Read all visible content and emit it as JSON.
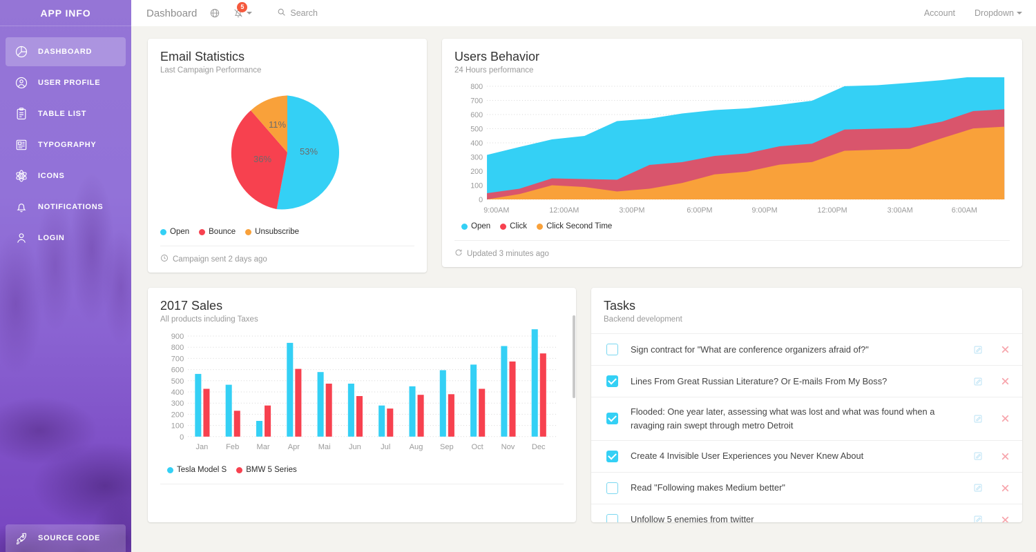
{
  "sidebar": {
    "brand": "APP INFO",
    "items": [
      {
        "label": "DASHBOARD",
        "icon": "pie-chart-icon",
        "active": true
      },
      {
        "label": "USER PROFILE",
        "icon": "user-circle-icon",
        "active": false
      },
      {
        "label": "TABLE LIST",
        "icon": "clipboard-icon",
        "active": false
      },
      {
        "label": "TYPOGRAPHY",
        "icon": "newspaper-icon",
        "active": false
      },
      {
        "label": "ICONS",
        "icon": "atom-icon",
        "active": false
      },
      {
        "label": "NOTIFICATIONS",
        "icon": "bell-icon",
        "active": false
      },
      {
        "label": "LOGIN",
        "icon": "user-icon",
        "active": false
      }
    ],
    "source_code": {
      "label": "SOURCE CODE",
      "icon": "rocket-icon"
    }
  },
  "topbar": {
    "title": "Dashboard",
    "globe_icon": "globe-icon",
    "notifications_icon": "bell-icon",
    "notifications_badge": "5",
    "search_icon": "search-icon",
    "search_label": "Search",
    "account_label": "Account",
    "dropdown_label": "Dropdown"
  },
  "cards": {
    "email_statistics": {
      "title": "Email Statistics",
      "subtitle": "Last Campaign Performance",
      "footer_icon": "clock-icon",
      "footer": "Campaign sent 2 days ago"
    },
    "users_behavior": {
      "title": "Users Behavior",
      "subtitle": "24 Hours performance",
      "footer_icon": "refresh-icon",
      "footer": "Updated 3 minutes ago"
    },
    "sales_2017": {
      "title": "2017 Sales",
      "subtitle": "All products including Taxes"
    },
    "tasks": {
      "title": "Tasks",
      "subtitle": "Backend development",
      "edit_icon": "edit-icon",
      "delete_icon": "close-icon",
      "items": [
        {
          "text": "Sign contract for \"What are conference organizers afraid of?\"",
          "done": false
        },
        {
          "text": "Lines From Great Russian Literature? Or E-mails From My Boss?",
          "done": true
        },
        {
          "text": "Flooded: One year later, assessing what was lost and what was found when a ravaging rain swept through metro Detroit",
          "done": true
        },
        {
          "text": "Create 4 Invisible User Experiences you Never Knew About",
          "done": true
        },
        {
          "text": "Read \"Following makes Medium better\"",
          "done": false
        },
        {
          "text": "Unfollow 5 enemies from twitter",
          "done": false
        }
      ]
    }
  },
  "colors": {
    "cyan": "#34d0f5",
    "red": "#f7414f",
    "orange": "#f9a13a",
    "pink": "#d9556c",
    "purple": "#8a63d2",
    "text": "#444444",
    "muted": "#9a9a9a"
  },
  "chart_data": [
    {
      "type": "pie",
      "title": "Email Statistics",
      "subtitle": "Last Campaign Performance",
      "labels": [
        "Open",
        "Bounce",
        "Unsubscribe"
      ],
      "values": [
        53,
        36,
        11
      ],
      "value_labels": [
        "53%",
        "36%",
        "11%"
      ],
      "colors": [
        "#34d0f5",
        "#f7414f",
        "#f9a13a"
      ],
      "legend_position": "bottom"
    },
    {
      "type": "area",
      "title": "Users Behavior",
      "subtitle": "24 Hours performance",
      "stacked": true,
      "x": [
        "9:00AM",
        "12:00AM",
        "3:00PM",
        "6:00PM",
        "9:00PM",
        "12:00PM",
        "3:00AM",
        "6:00AM"
      ],
      "xticks": [
        "9:00AM",
        "12:00AM",
        "3:00PM",
        "6:00PM",
        "9:00PM",
        "12:00PM",
        "3:00AM",
        "6:00AM"
      ],
      "yticks": [
        0,
        100,
        200,
        300,
        400,
        500,
        600,
        700,
        800
      ],
      "ylim": [
        0,
        800
      ],
      "grid": true,
      "legend_position": "bottom",
      "series": [
        {
          "name": "Click Second Time",
          "color": "#f9a13a",
          "values": [
            0,
            30,
            80,
            70,
            45,
            60,
            95,
            145,
            160,
            200,
            215,
            275,
            280,
            285,
            345,
            400,
            410
          ]
        },
        {
          "name": "Click",
          "color": "#d9556c",
          "values": [
            35,
            60,
            120,
            115,
            110,
            195,
            210,
            245,
            260,
            300,
            315,
            395,
            400,
            405,
            440,
            500,
            510
          ]
        },
        {
          "name": "Open",
          "color": "#34d0f5",
          "values": [
            255,
            300,
            345,
            365,
            450,
            465,
            495,
            515,
            525,
            545,
            570,
            655,
            660,
            675,
            690,
            715,
            725
          ]
        }
      ]
    },
    {
      "type": "bar",
      "title": "2017 Sales",
      "subtitle": "All products including Taxes",
      "categories": [
        "Jan",
        "Feb",
        "Mar",
        "Apr",
        "Mai",
        "Jun",
        "Jul",
        "Aug",
        "Sep",
        "Oct",
        "Nov",
        "Dec"
      ],
      "yticks": [
        0,
        100,
        200,
        300,
        400,
        500,
        600,
        700,
        800,
        900
      ],
      "ylim": [
        0,
        900
      ],
      "grid": true,
      "legend_position": "bottom",
      "series": [
        {
          "name": "Tesla Model S",
          "color": "#34d0f5",
          "values": [
            505,
            415,
            290,
            755,
            520,
            425,
            295,
            405,
            535,
            580,
            730,
            865
          ]
        },
        {
          "name": "BMW 5 Series",
          "color": "#f7414f",
          "values": [
            385,
            210,
            250,
            545,
            425,
            325,
            270,
            335,
            340,
            385,
            605,
            670
          ]
        }
      ]
    }
  ]
}
